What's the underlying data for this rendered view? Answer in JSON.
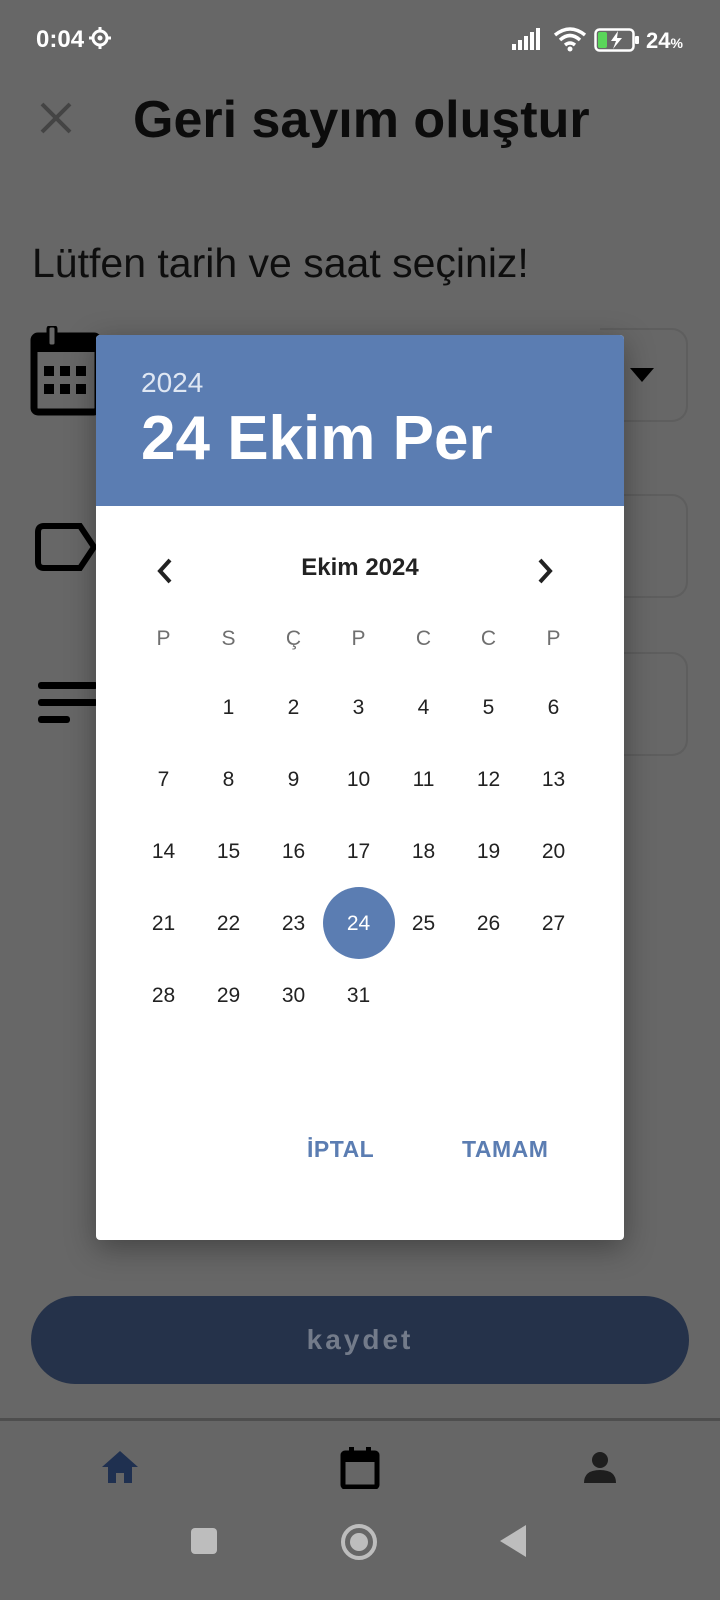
{
  "status_bar": {
    "time": "0:04",
    "battery_percent": "24",
    "battery_unit": "%"
  },
  "page": {
    "title": "Geri sayım oluştur",
    "prompt": "Lütfen tarih ve saat seçiniz!",
    "save_label": "kaydet"
  },
  "dialog": {
    "header_year": "2024",
    "header_date": "24 Ekim Per",
    "month_label": "Ekim 2024",
    "weekdays": [
      "P",
      "S",
      "Ç",
      "P",
      "C",
      "C",
      "P"
    ],
    "weeks": [
      [
        "",
        "1",
        "2",
        "3",
        "4",
        "5",
        "6"
      ],
      [
        "7",
        "8",
        "9",
        "10",
        "11",
        "12",
        "13"
      ],
      [
        "14",
        "15",
        "16",
        "17",
        "18",
        "19",
        "20"
      ],
      [
        "21",
        "22",
        "23",
        "24",
        "25",
        "26",
        "27"
      ],
      [
        "28",
        "29",
        "30",
        "31",
        "",
        "",
        ""
      ]
    ],
    "selected_day": "24",
    "cancel_label": "İPTAL",
    "ok_label": "TAMAM"
  },
  "icons": {
    "close": "close-icon",
    "calendar": "calendar-icon",
    "label": "label-icon",
    "notes": "notes-icon",
    "dropdown": "dropdown-arrow-icon",
    "home": "home-icon",
    "profile": "person-icon"
  },
  "colors": {
    "accent": "#5b7db2",
    "scrim": "#676767",
    "save_button": "#25324a"
  }
}
